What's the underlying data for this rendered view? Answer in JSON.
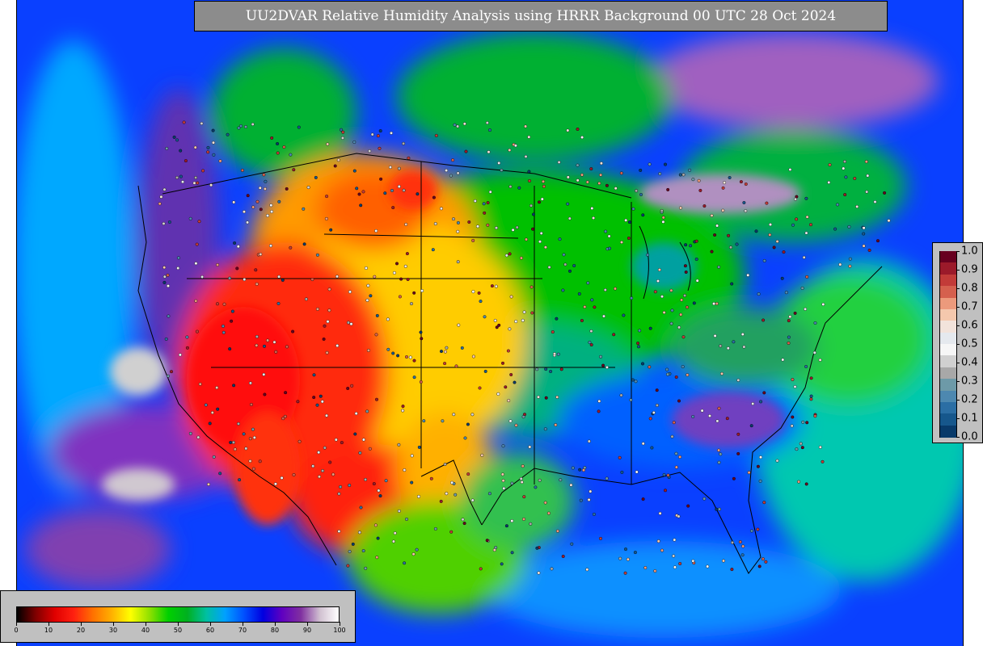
{
  "title": "UU2DVAR Relative Humidity Analysis using HRRR Background 00 UTC 28 Oct 2024",
  "humidity_colorbar": {
    "min": 0,
    "max": 100,
    "tick_labels": [
      "0",
      "10",
      "20",
      "30",
      "40",
      "50",
      "60",
      "70",
      "80",
      "90",
      "100"
    ],
    "stops": [
      "#000000",
      "#800000",
      "#e00000",
      "#ff2010",
      "#ff7000",
      "#ffb000",
      "#ffff00",
      "#90e000",
      "#00d000",
      "#00b020",
      "#00c0a0",
      "#00a0ff",
      "#0050ff",
      "#0000e0",
      "#6000c0",
      "#8030a0",
      "#d0c0d0",
      "#ffffff"
    ]
  },
  "observation_colorbar": {
    "tick_labels": [
      "1.0",
      "0.9",
      "0.8",
      "0.7",
      "0.6",
      "0.5",
      "0.4",
      "0.3",
      "0.2",
      "0.1",
      "0.0"
    ],
    "segments": [
      "#67001f",
      "#9b1a2a",
      "#c23b38",
      "#d5604e",
      "#ec9a7c",
      "#f5c8ad",
      "#f2e3db",
      "#e5e9ee",
      "#f6f6f6",
      "#d0d0d0",
      "#a8a8a8",
      "#6d9aa8",
      "#4d88b0",
      "#2b6ea4",
      "#16578c",
      "#083a6a"
    ]
  },
  "colors": {
    "ocean_blue": "#0a40ff",
    "land_green": "#00c400",
    "dry_red": "#ff1a0a",
    "frame_gray": "#c0c0c0",
    "title_bg": "#8c8c8c"
  }
}
